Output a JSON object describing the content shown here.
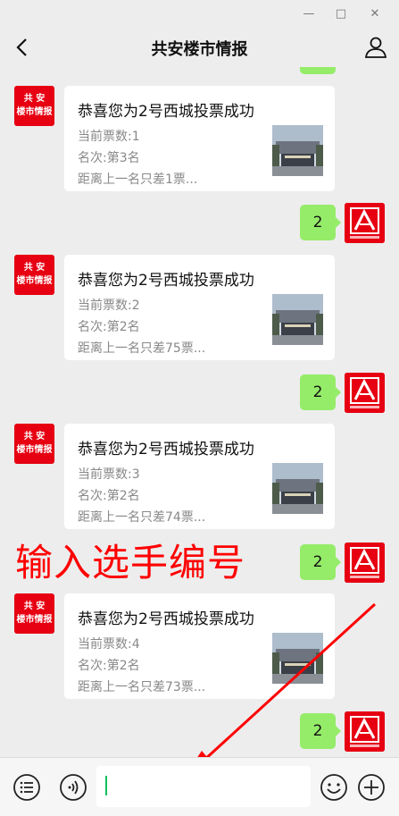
{
  "window": {
    "minimize_icon": "minimize-icon",
    "maximize_icon": "maximize-icon",
    "close_icon": "close-icon"
  },
  "header": {
    "title": "共安楼市情报"
  },
  "official_account": {
    "avatar_text_line1": "共 安",
    "avatar_text_line2": "楼市情报"
  },
  "messages": [
    {
      "title": "恭喜您为2号西城投票成功",
      "votes": "当前票数:1",
      "rank": "名次:第3名",
      "gap": "距离上一名只差1票..."
    },
    {
      "title": "恭喜您为2号西城投票成功",
      "votes": "当前票数:2",
      "rank": "名次:第2名",
      "gap": "距离上一名只差75票..."
    },
    {
      "title": "恭喜您为2号西城投票成功",
      "votes": "当前票数:3",
      "rank": "名次:第2名",
      "gap": "距离上一名只差74票..."
    },
    {
      "title": "恭喜您为2号西城投票成功",
      "votes": "当前票数:4",
      "rank": "名次:第2名",
      "gap": "距离上一名只差73票..."
    }
  ],
  "replies": [
    "2",
    "2",
    "2",
    "2"
  ],
  "annotation": {
    "text": "输入选手编号",
    "color": "#ff0000"
  },
  "input": {
    "value": ""
  },
  "colors": {
    "bubble_green": "#95ec69",
    "brand_red": "#e60012",
    "background": "#ededed"
  }
}
